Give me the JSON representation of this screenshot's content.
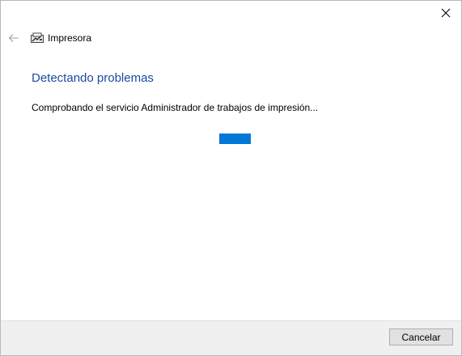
{
  "window": {
    "title": "Impresora",
    "back_icon": "back-arrow-icon",
    "app_icon": "printer-troubleshooter-icon",
    "close_icon": "close-icon"
  },
  "content": {
    "heading": "Detectando problemas",
    "status": "Comprobando el servicio Administrador de trabajos de impresión...",
    "progress_color": "#0078d7"
  },
  "footer": {
    "cancel_label": "Cancelar"
  },
  "colors": {
    "heading": "#1a4ba0",
    "accent": "#0078d7",
    "footer_bg": "#f0f0f0"
  }
}
